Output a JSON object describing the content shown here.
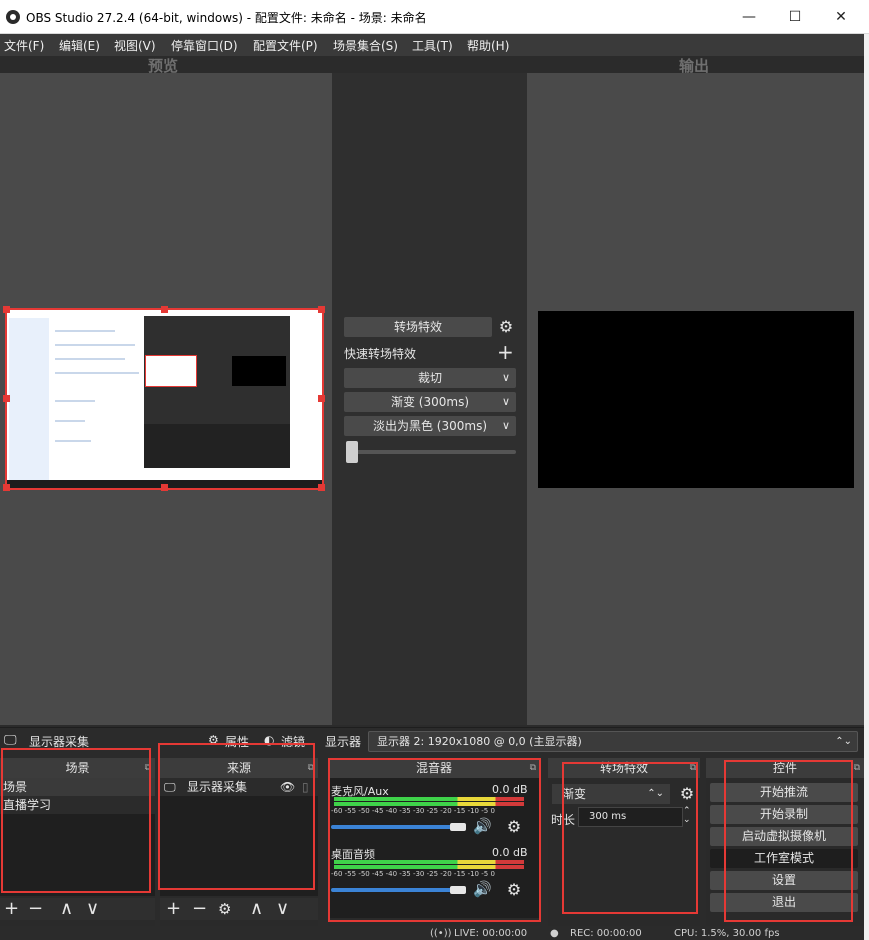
{
  "window": {
    "title": "OBS Studio 27.2.4 (64-bit, windows) - 配置文件: 未命名 - 场景: 未命名",
    "minimize": "—",
    "maximize": "☐",
    "close": "✕"
  },
  "menu": [
    "文件(F)",
    "编辑(E)",
    "视图(V)",
    "停靠窗口(D)",
    "配置文件(P)",
    "场景集合(S)",
    "工具(T)",
    "帮助(H)"
  ],
  "preview": {
    "label": "预览"
  },
  "program": {
    "label": "输出"
  },
  "studio_transition": {
    "button": "转场特效",
    "quick_label": "快速转场特效",
    "quick_items": [
      "裁切",
      "渐变 (300ms)",
      "淡出为黑色 (300ms)"
    ],
    "tbar_value": 0
  },
  "context_bar": {
    "source_name": "显示器采集",
    "properties": "属性",
    "filters": "滤镜",
    "monitor_label": "显示器",
    "monitor_value": "显示器 2: 1920x1080 @ 0,0 (主显示器)"
  },
  "scenes": {
    "title": "场景",
    "items": [
      "场景",
      "直播学习"
    ],
    "toolbar": [
      "+",
      "−",
      "∧",
      "∨"
    ]
  },
  "sources": {
    "title": "来源",
    "items": [
      {
        "name": "显示器采集",
        "icon": "monitor-icon"
      }
    ],
    "toolbar": [
      "+",
      "−",
      "⚙",
      "∧",
      "∨"
    ]
  },
  "mixer": {
    "title": "混音器",
    "ticks": "-60 -55 -50 -45 -40 -35 -30 -25 -20 -15 -10 -5 0",
    "channels": [
      {
        "name": "麦克风/Aux",
        "db": "0.0 dB",
        "volume": 0.98
      },
      {
        "name": "桌面音频",
        "db": "0.0 dB",
        "volume": 0.98
      }
    ]
  },
  "transitions_dock": {
    "title": "转场特效",
    "selected": "渐变",
    "duration_label": "时长",
    "duration_value": "300 ms"
  },
  "controls": {
    "title": "控件",
    "buttons": [
      "开始推流",
      "开始录制",
      "启动虚拟摄像机",
      "工作室模式",
      "设置",
      "退出"
    ],
    "active_index": 3
  },
  "status": {
    "live": "LIVE: 00:00:00",
    "rec": "REC: 00:00:00",
    "cpu": "CPU: 1.5%, 30.00 fps"
  },
  "colors": {
    "highlight_red": "#e53935",
    "volume_blue": "#3b83d6"
  }
}
